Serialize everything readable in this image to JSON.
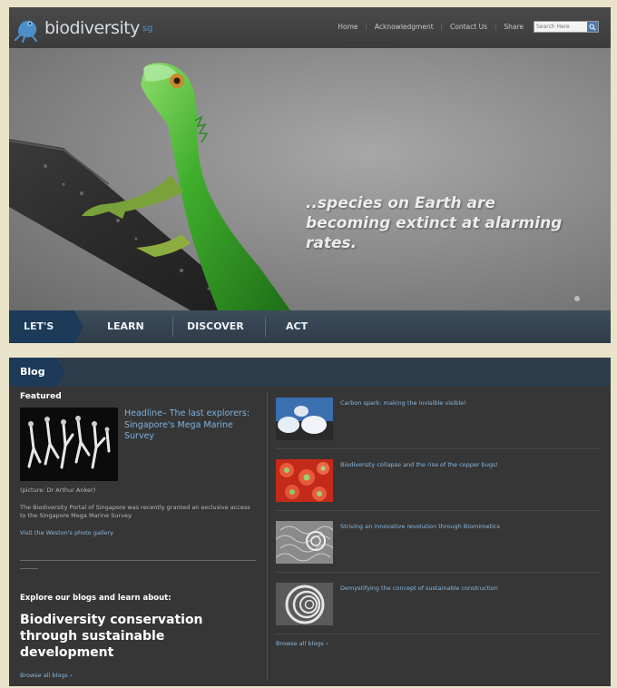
{
  "header": {
    "logo_text": "biodiversity",
    "logo_suffix": "sg",
    "nav": [
      "Home",
      "Acknowledgment",
      "Contact Us",
      "Share"
    ],
    "search_placeholder": "Search Here"
  },
  "hero": {
    "caption": "..species on Earth are becoming extinct at alarming rates."
  },
  "mainnav": {
    "items": [
      "LET'S",
      "LEARN",
      "DISCOVER",
      "ACT"
    ]
  },
  "blog": {
    "tab_label": "Blog",
    "featured": {
      "label": "Featured",
      "headline": "Headline– The last explorers: Singapore's Mega Marine Survey",
      "credit": "(picture: Dr Arthur Anker)",
      "description": "The Biodiversity Portal of Singapore was recently granted an exclusive access to the Singapore Mega Marine Survey.",
      "photo_link": "Visit the Weston's photo gallery"
    },
    "explore": {
      "label": "Explore our blogs and learn about:",
      "topic": "Biodiversity conservation through sustainable development",
      "browse": "Browse all blogs ›"
    },
    "posts": [
      {
        "title": "Carbon spark: making the invisible visible!"
      },
      {
        "title": "Biodiversity collapse and the rise of the copper bugs!"
      },
      {
        "title": "Striving an innovative revolution through Biomimetics"
      },
      {
        "title": "Demystifying the concept of sustainable construction"
      }
    ],
    "browse_all": "Browse all blogs ›"
  },
  "colors": {
    "accent": "#1d3a58",
    "link": "#8ab8de",
    "background": "#363636"
  }
}
